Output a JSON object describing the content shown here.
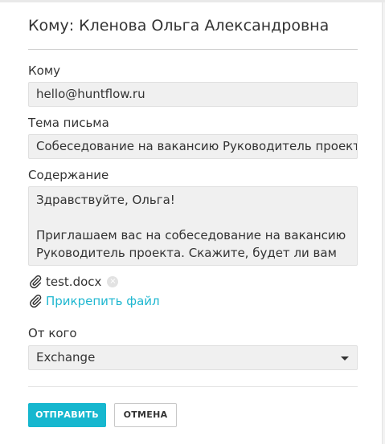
{
  "dialog": {
    "title": "Кому: Кленова Ольга Александровна"
  },
  "to": {
    "label": "Кому",
    "value": "hello@huntflow.ru"
  },
  "subject": {
    "label": "Тема письма",
    "value": "Собеседование на вакансию Руководитель проекта"
  },
  "body": {
    "label": "Содержание",
    "lines": [
      "Здравствуйте, Ольга!",
      "",
      "Приглашаем вас на собеседование на вакансию",
      "Руководитель проекта. Скажите, будет ли вам"
    ]
  },
  "attachments": {
    "file_name": "test.docx",
    "remove_glyph": "×",
    "attach_link": "Прикрепить файл"
  },
  "from": {
    "label": "От кого",
    "selected": "Exchange"
  },
  "actions": {
    "send_label": "ОТПРАВИТЬ",
    "cancel_label": "ОТМЕНА"
  },
  "colors": {
    "accent": "#16b7cf",
    "link": "#1fb7d0",
    "field_bg": "#f0f0f0"
  },
  "icons": {
    "attachment": "paperclip-icon",
    "remove": "remove-circle-icon",
    "dropdown": "chevron-down-icon"
  }
}
